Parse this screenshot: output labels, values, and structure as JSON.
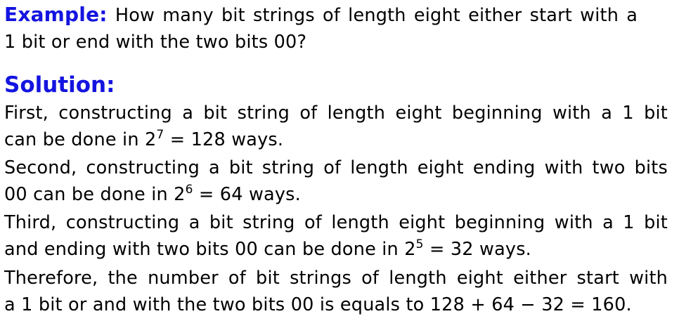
{
  "example": {
    "label": "Example:",
    "question_line1": "How many bit strings of length eight either start with a",
    "question_line2": "1 bit or end with the two bits 00?"
  },
  "solution": {
    "label": "Solution:",
    "paragraphs": [
      {
        "line1": "First, constructing a bit string of length eight beginning with a 1 bit",
        "line2_pre": "can be done in 2",
        "line2_exp": "7",
        "line2_post": " = 128 ways."
      },
      {
        "line1": "Second, constructing a bit string of length eight ending with two bits",
        "line2_pre": "00 can be done in 2",
        "line2_exp": "6",
        "line2_post": " = 64 ways."
      },
      {
        "line1": "Third, constructing a bit string of length eight beginning with a 1 bit",
        "line2_pre": "and ending with two bits 00 can be done in 2",
        "line2_exp": "5",
        "line2_post": " = 32 ways."
      },
      {
        "line1": "Therefore, the number of bit strings of length eight either start with",
        "line2": "a 1 bit or and with the two bits 00 is equals to 128 + 64 − 32 = 160."
      }
    ]
  },
  "colors": {
    "heading": "#1414e0",
    "text": "#000000",
    "background": "#ffffff"
  }
}
